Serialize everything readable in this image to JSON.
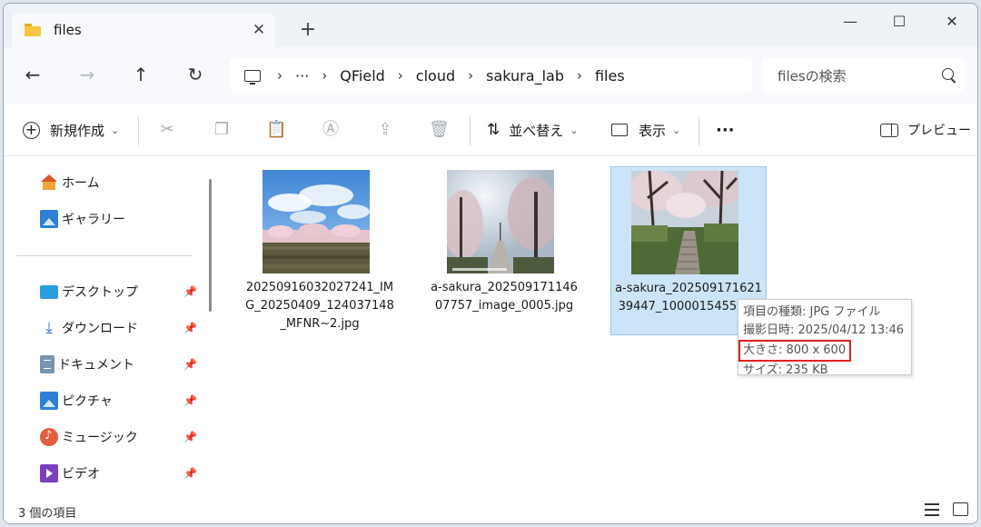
{
  "window": {
    "tab_title": "files",
    "tab_close": "✕",
    "new_tab": "+",
    "controls": {
      "minimize": "—",
      "maximize": "☐",
      "close": "✕"
    }
  },
  "nav": {
    "back": "←",
    "forward": "→",
    "up": "↑",
    "refresh": "↻"
  },
  "breadcrumb": {
    "ellipsis": "···",
    "sep": "›",
    "items": [
      "QField",
      "cloud",
      "sakura_lab",
      "files"
    ]
  },
  "search": {
    "placeholder": "filesの検索"
  },
  "toolbar": {
    "new_label": "新規作成",
    "sort_label": "並べ替え",
    "view_label": "表示",
    "more_label": "···",
    "preview_label": "プレビュー"
  },
  "sidebar": {
    "items": [
      {
        "label": "ホーム",
        "icon": "home-icon"
      },
      {
        "label": "ギャラリー",
        "icon": "gallery-icon"
      },
      {
        "label": "デスクトップ",
        "icon": "desktop-icon",
        "pinned": true
      },
      {
        "label": "ダウンロード",
        "icon": "download-icon",
        "pinned": true
      },
      {
        "label": "ドキュメント",
        "icon": "documents-icon",
        "pinned": true
      },
      {
        "label": "ピクチャ",
        "icon": "pictures-icon",
        "pinned": true
      },
      {
        "label": "ミュージック",
        "icon": "music-icon",
        "pinned": true
      },
      {
        "label": "ビデオ",
        "icon": "video-icon",
        "pinned": true
      }
    ],
    "pin_glyph": "📌"
  },
  "files": [
    {
      "name": "20250916032027241_IMG_20250409_124037148_MFNR~2.jpg",
      "selected": false
    },
    {
      "name": "a-sakura_20250917114607757_image_0005.jpg",
      "selected": false
    },
    {
      "name": "a-sakura_20250917162139447_1000015455.jpg",
      "selected": true
    }
  ],
  "tooltip": {
    "type": "項目の種類: JPG ファイル",
    "date": "撮影日時: 2025/04/12 13:46",
    "dimensions": "大きさ: 800 x 600",
    "size": "サイズ: 235 KB"
  },
  "status": {
    "count": "3 個の項目"
  },
  "colors": {
    "selection": "#cce4f7",
    "highlight_box": "#e0221d"
  }
}
